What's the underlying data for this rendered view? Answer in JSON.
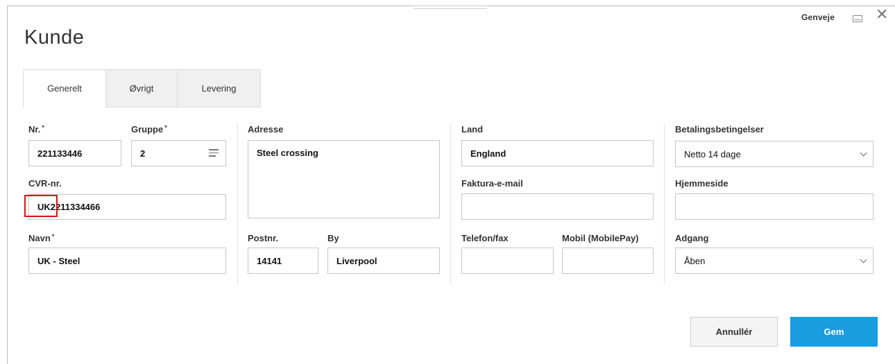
{
  "dialog": {
    "title": "Kunde",
    "shortcut_label": "Genveje"
  },
  "tabs": [
    {
      "label": "Generelt",
      "active": true
    },
    {
      "label": "Øvrigt",
      "active": false
    },
    {
      "label": "Levering",
      "active": false
    }
  ],
  "form": {
    "nr": {
      "label": "Nr.",
      "required_mark": "*",
      "value": "221133446"
    },
    "gruppe": {
      "label": "Gruppe",
      "required_mark": "*",
      "value": "2"
    },
    "cvr": {
      "label": "CVR-nr.",
      "value": "UK2211334466"
    },
    "navn": {
      "label": "Navn",
      "required_mark": "*",
      "value": "UK - Steel"
    },
    "adresse": {
      "label": "Adresse",
      "value": "Steel crossing"
    },
    "postnr": {
      "label": "Postnr.",
      "value": "14141"
    },
    "by": {
      "label": "By",
      "value": "Liverpool"
    },
    "land": {
      "label": "Land",
      "value": "England"
    },
    "faktura_email": {
      "label": "Faktura-e-mail",
      "value": ""
    },
    "telefon": {
      "label": "Telefon/fax",
      "value": ""
    },
    "mobil": {
      "label": "Mobil (MobilePay)",
      "value": ""
    },
    "betaling": {
      "label": "Betalingsbetingelser",
      "value": "Netto 14 dage"
    },
    "hjemmeside": {
      "label": "Hjemmeside",
      "value": ""
    },
    "adgang": {
      "label": "Adgang",
      "value": "Åben"
    }
  },
  "buttons": {
    "cancel": "Annullér",
    "save": "Gem"
  },
  "colors": {
    "primary": "#1a9de0",
    "highlight": "#e01010"
  }
}
